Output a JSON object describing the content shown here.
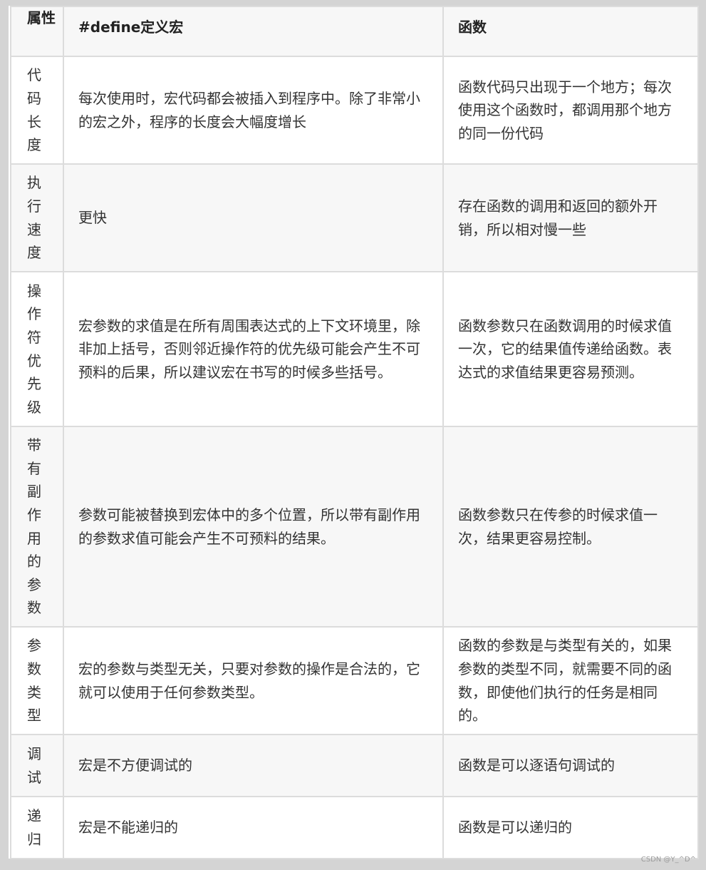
{
  "table": {
    "headers": [
      "属性",
      "#define定义宏",
      "函数"
    ],
    "rows": [
      {
        "attribute": "代码长度",
        "macro": "每次使用时，宏代码都会被插入到程序中。除了非常小的宏之外，程序的长度会大幅度增长",
        "function": "函数代码只出现于一个地方；每次使用这个函数时，都调用那个地方的同一份代码"
      },
      {
        "attribute": "执行速度",
        "macro": "更快",
        "function": "存在函数的调用和返回的额外开销，所以相对慢一些"
      },
      {
        "attribute": "操作符优先级",
        "macro": "宏参数的求值是在所有周围表达式的上下文环境里，除非加上括号，否则邻近操作符的优先级可能会产生不可预料的后果，所以建议宏在书写的时候多些括号。",
        "function": "函数参数只在函数调用的时候求值一次，它的结果值传递给函数。表达式的求值结果更容易预测。"
      },
      {
        "attribute": "带有副作用的参数",
        "macro": "参数可能被替换到宏体中的多个位置，所以带有副作用的参数求值可能会产生不可预料的结果。",
        "function": "函数参数只在传参的时候求值一次，结果更容易控制。"
      },
      {
        "attribute": "参数类型",
        "macro": "宏的参数与类型无关，只要对参数的操作是合法的，它就可以使用于任何参数类型。",
        "function": "函数的参数是与类型有关的，如果参数的类型不同，就需要不同的函数，即使他们执行的任务是相同的。"
      },
      {
        "attribute": "调试",
        "macro": "宏是不方便调试的",
        "function": "函数是可以逐语句调试的"
      },
      {
        "attribute": "递归",
        "macro": "宏是不能递归的",
        "function": "函数是可以递归的"
      }
    ]
  },
  "watermark": "CSDN @Y_^D^"
}
